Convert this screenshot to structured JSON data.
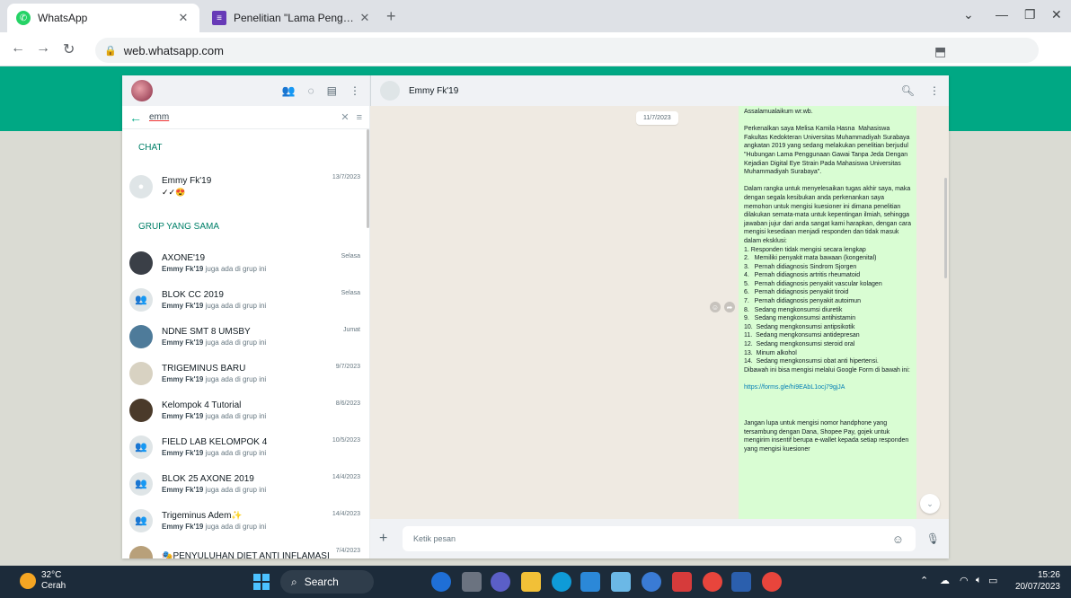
{
  "browser": {
    "tabs": [
      {
        "title": "WhatsApp",
        "favicon": "whatsapp-icon"
      },
      {
        "title": "Penelitian \"Lama Penggunaan Ga",
        "favicon": "forms-icon"
      }
    ],
    "url": "web.whatsapp.com"
  },
  "sidebar": {
    "search_query": "emm",
    "section_chat": "CHAT",
    "section_groups": "GRUP YANG SAMA",
    "contact": {
      "name": "Emmy Fk'19",
      "time": "13/7/2023",
      "status": "✓✓😍"
    },
    "groups": [
      {
        "name": "AXONE'19",
        "time": "Selasa",
        "sub_name": "Emmy Fk'19",
        "sub_rest": " juga ada di grup ini",
        "avatar": "photo",
        "color": "#3a3f47"
      },
      {
        "name": "BLOK CC 2019",
        "time": "Selasa",
        "sub_name": "Emmy Fk'19",
        "sub_rest": " juga ada di grup ini",
        "avatar": "group",
        "color": "#dfe5e7"
      },
      {
        "name": "NDNE SMT 8 UMSBY",
        "time": "Jumat",
        "sub_name": "Emmy Fk'19",
        "sub_rest": " juga ada di grup ini",
        "avatar": "photo",
        "color": "#4e7b9a"
      },
      {
        "name": "TRIGEMINUS BARU",
        "time": "9/7/2023",
        "sub_name": "Emmy Fk'19",
        "sub_rest": " juga ada di grup ini",
        "avatar": "photo",
        "color": "#d8d2c2"
      },
      {
        "name": "Kelompok 4 Tutorial",
        "time": "8/6/2023",
        "sub_name": "Emmy Fk'19",
        "sub_rest": " juga ada di grup ini",
        "avatar": "photo",
        "color": "#4a3a2a"
      },
      {
        "name": "FIELD LAB KELOMPOK 4",
        "time": "10/5/2023",
        "sub_name": "Emmy Fk'19",
        "sub_rest": " juga ada di grup ini",
        "avatar": "group",
        "color": "#dfe5e7"
      },
      {
        "name": "BLOK 25 AXONE 2019",
        "time": "14/4/2023",
        "sub_name": "Emmy Fk'19",
        "sub_rest": " juga ada di grup ini",
        "avatar": "group",
        "color": "#dfe5e7"
      },
      {
        "name": "Trigeminus Adem✨",
        "time": "14/4/2023",
        "sub_name": "Emmy Fk'19",
        "sub_rest": " juga ada di grup ini",
        "avatar": "group",
        "color": "#dfe5e7"
      },
      {
        "name": "🎭PENYULUHAN DIET ANTI INFLAMASI",
        "time": "7/4/2023",
        "sub_name": "",
        "sub_rest": "",
        "avatar": "photo",
        "color": "#b8a07a"
      }
    ]
  },
  "conversation": {
    "name": "Emmy Fk'19",
    "date": "11/7/2023",
    "message": "Assalamualaikum wr.wb.\n\nPerkenalkan saya Melisa Kamila Hasna  Mahasiswa Fakultas Kedokteran Universitas Muhammadiyah Surabaya angkatan 2019 yang sedang melakukan penelitian berjudul \"Hubungan Lama Penggunaan Gawai Tanpa Jeda Dengan Kejadian Digital Eye Strain Pada Mahasiswa Universitas Muhammadiyah Surabaya\".\n\nDalam rangka untuk menyelesaikan tugas akhir saya, maka dengan segala kesibukan anda perkenankan saya memohon untuk mengisi kuesioner ini dimana penelitian dilakukan semata-mata untuk kepentingan ilmiah, sehingga jawaban jujur dari anda sangat kami harapkan, dengan cara mengisi kesediaan menjadi responden dan tidak masuk dalam eksklusi:\n1. Responden tidak mengisi secara lengkap\n2.   Memiliki penyakit mata bawaan (kongenital)\n3.   Pernah didiagnosis Sindrom Sjorgen\n4.   Pernah didiagnosis artritis rheumatoid\n5.   Pernah didiagnosis penyakit vascular kolagen\n6.   Pernah didiagnosis penyakit tiroid\n7.   Pernah didiagnosis penyakit autoimun\n8.   Sedang mengkonsumsi diuretik\n9.   Sedang mengkonsumsi antihistamin\n10.  Sedang mengkonsumsi antipsikotik\n11.  Sedang mengkonsumsi antidepresan\n12.  Sedang mengkonsumsi steroid oral\n13.  Minum alkohol\n14.  Sedang mengkonsumsi obat anti hipertensi.\nDibawah ini bisa mengisi melalui Google Form di bawah ini:",
    "link": "https://forms.gle/hi9EAbL1ocj79gjJA",
    "message_after": "Jangan lupa untuk mengisi nomor handphone yang tersambung dengan Dana, Shopee Pay, gojek untuk mengirim insentif berupa e-wallet kepada setiap responden yang mengisi kuesioner",
    "composer_placeholder": "Ketik pesan"
  },
  "taskbar": {
    "temp": "32°C",
    "weather": "Cerah",
    "search": "Search",
    "time": "15:26",
    "date": "20/07/2023"
  },
  "colors": {
    "accent": "#00a884",
    "bubble": "#d9fdd3",
    "chat_bg": "#efeae2",
    "taskbar": "#1c2b3a"
  }
}
